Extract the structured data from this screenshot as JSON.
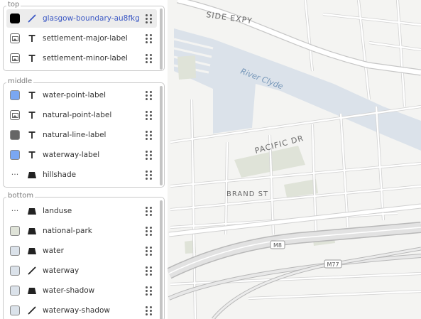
{
  "map": {
    "road_labels": {
      "expressway": "SIDE EXPY",
      "pacific": "PACIFIC DR",
      "brand": "BRAND ST"
    },
    "water_label": "River Clyde",
    "shields": [
      "M8",
      "M77"
    ],
    "colors": {
      "land": "#f4f4f2",
      "water": "#dbe2ea",
      "park": "#dfe3d8",
      "road": "#ffffff",
      "road_casing": "#d2d2d2",
      "motorway": "#e2e2e2",
      "motorway_casing": "#b8b8b8",
      "label": "#6b6b6b",
      "water_label": "#7596b8"
    }
  },
  "panel": {
    "groups": [
      {
        "title": "top",
        "layers": [
          {
            "name": "glasgow-boundary-au8fkg",
            "swatch": "black",
            "type": "line-icon",
            "selected": true
          },
          {
            "name": "settlement-major-label",
            "swatch": "image",
            "type": "text-icon",
            "selected": false
          },
          {
            "name": "settlement-minor-label",
            "swatch": "image",
            "type": "text-icon",
            "selected": false
          }
        ]
      },
      {
        "title": "middle",
        "layers": [
          {
            "name": "water-point-label",
            "swatch": "blue",
            "type": "text-icon",
            "selected": false
          },
          {
            "name": "natural-point-label",
            "swatch": "image",
            "type": "text-icon",
            "selected": false
          },
          {
            "name": "natural-line-label",
            "swatch": "gray",
            "type": "text-icon",
            "selected": false
          },
          {
            "name": "waterway-label",
            "swatch": "blue",
            "type": "text-icon",
            "selected": false
          },
          {
            "name": "hillshade",
            "swatch": "dots",
            "type": "fill-icon",
            "selected": false
          }
        ]
      },
      {
        "title": "bottom",
        "layers": [
          {
            "name": "landuse",
            "swatch": "dots",
            "type": "fill-icon",
            "selected": false
          },
          {
            "name": "national-park",
            "swatch": "green",
            "type": "fill-icon",
            "selected": false
          },
          {
            "name": "water",
            "swatch": "lightblue",
            "type": "fill-icon",
            "selected": false
          },
          {
            "name": "waterway",
            "swatch": "lightblue",
            "type": "line-icon",
            "selected": false
          },
          {
            "name": "water-shadow",
            "swatch": "lightblue",
            "type": "fill-icon",
            "selected": false
          },
          {
            "name": "waterway-shadow",
            "swatch": "lightblue",
            "type": "line-icon",
            "selected": false
          }
        ]
      }
    ],
    "swatch_colors": {
      "black": "#000000",
      "blue": "#7aa7f2",
      "gray": "#666666",
      "green": "#dfe3d8",
      "lightblue": "#dbe2ea"
    },
    "dots_glyph": "...",
    "accent": "#3b58c4"
  }
}
